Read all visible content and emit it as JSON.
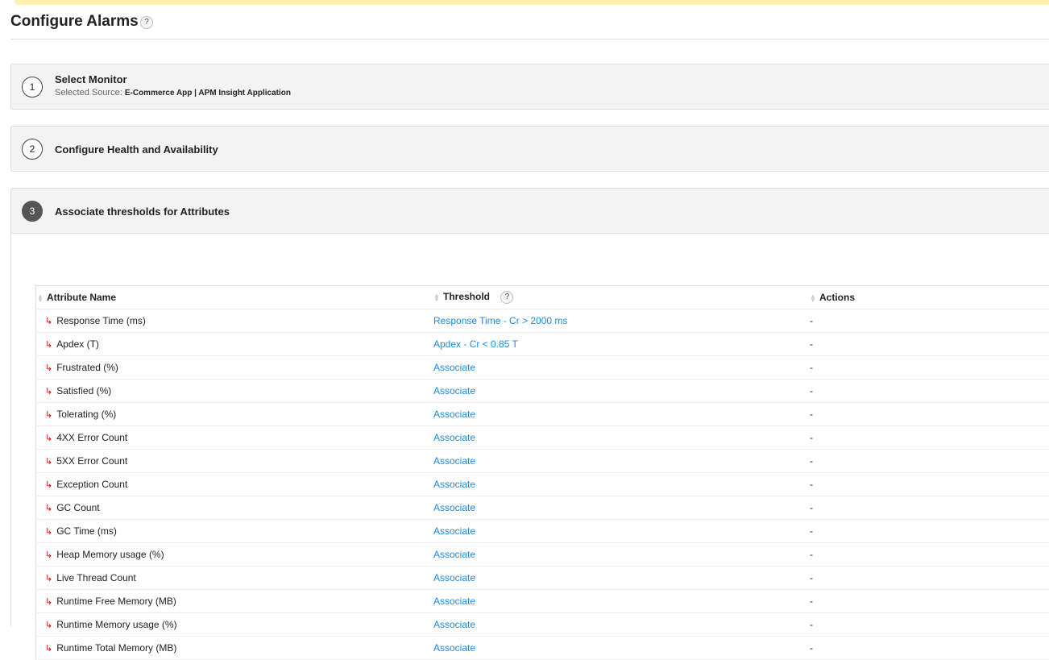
{
  "title": "Configure Alarms",
  "help": "?",
  "steps": [
    {
      "num": "1",
      "title": "Select Monitor",
      "sub_label": "Selected Source:",
      "source": "E-Commerce App | APM Insight Application"
    },
    {
      "num": "2",
      "title": "Configure Health and Availability"
    },
    {
      "num": "3",
      "title": "Associate thresholds for Attributes"
    }
  ],
  "table": {
    "headers": [
      "Attribute Name",
      "Threshold",
      "Actions"
    ],
    "rows": [
      {
        "name": "Response Time (ms)",
        "threshold": "Response Time - Cr > 2000 ms",
        "action": "-"
      },
      {
        "name": "Apdex (T)",
        "threshold": "Apdex - Cr < 0.85 T",
        "action": "-"
      },
      {
        "name": "Frustrated (%)",
        "threshold": "Associate",
        "action": "-"
      },
      {
        "name": "Satisfied (%)",
        "threshold": "Associate",
        "action": "-"
      },
      {
        "name": "Tolerating (%)",
        "threshold": "Associate",
        "action": "-"
      },
      {
        "name": "4XX Error Count",
        "threshold": "Associate",
        "action": "-"
      },
      {
        "name": "5XX Error Count",
        "threshold": "Associate",
        "action": "-"
      },
      {
        "name": "Exception Count",
        "threshold": "Associate",
        "action": "-"
      },
      {
        "name": "GC Count",
        "threshold": "Associate",
        "action": "-"
      },
      {
        "name": "GC Time (ms)",
        "threshold": "Associate",
        "action": "-"
      },
      {
        "name": "Heap Memory usage (%)",
        "threshold": "Associate",
        "action": "-"
      },
      {
        "name": "Live Thread Count",
        "threshold": "Associate",
        "action": "-"
      },
      {
        "name": "Runtime Free Memory (MB)",
        "threshold": "Associate",
        "action": "-"
      },
      {
        "name": "Runtime Memory usage (%)",
        "threshold": "Associate",
        "action": "-"
      },
      {
        "name": "Runtime Total Memory (MB)",
        "threshold": "Associate",
        "action": "-"
      }
    ]
  }
}
